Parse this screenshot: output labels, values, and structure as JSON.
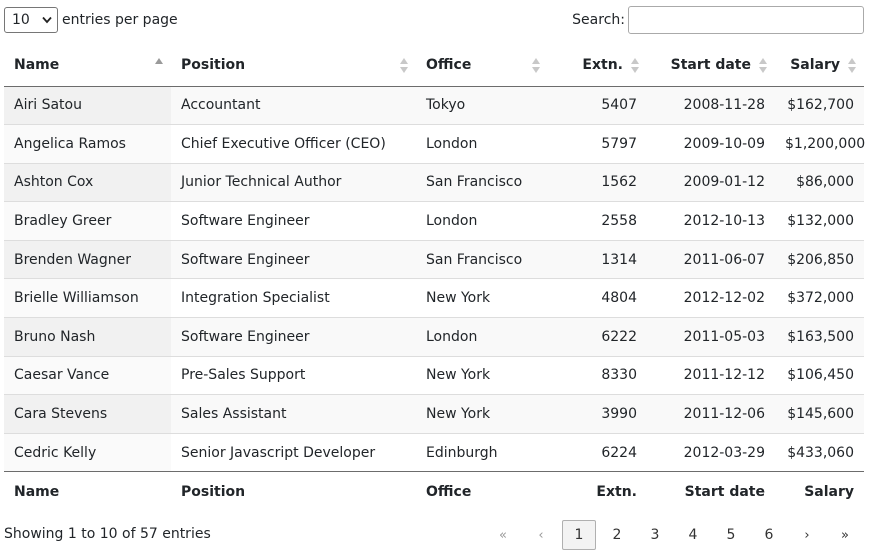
{
  "length": {
    "value": "10",
    "label": "entries per page"
  },
  "search": {
    "label": "Search:",
    "value": "",
    "placeholder": ""
  },
  "table": {
    "columns": [
      "Name",
      "Position",
      "Office",
      "Extn.",
      "Start date",
      "Salary"
    ],
    "rows": [
      [
        "Airi Satou",
        "Accountant",
        "Tokyo",
        "5407",
        "2008-11-28",
        "$162,700"
      ],
      [
        "Angelica Ramos",
        "Chief Executive Officer (CEO)",
        "London",
        "5797",
        "2009-10-09",
        "$1,200,000"
      ],
      [
        "Ashton Cox",
        "Junior Technical Author",
        "San Francisco",
        "1562",
        "2009-01-12",
        "$86,000"
      ],
      [
        "Bradley Greer",
        "Software Engineer",
        "London",
        "2558",
        "2012-10-13",
        "$132,000"
      ],
      [
        "Brenden Wagner",
        "Software Engineer",
        "San Francisco",
        "1314",
        "2011-06-07",
        "$206,850"
      ],
      [
        "Brielle Williamson",
        "Integration Specialist",
        "New York",
        "4804",
        "2012-12-02",
        "$372,000"
      ],
      [
        "Bruno Nash",
        "Software Engineer",
        "London",
        "6222",
        "2011-05-03",
        "$163,500"
      ],
      [
        "Caesar Vance",
        "Pre-Sales Support",
        "New York",
        "8330",
        "2011-12-12",
        "$106,450"
      ],
      [
        "Cara Stevens",
        "Sales Assistant",
        "New York",
        "3990",
        "2011-12-06",
        "$145,600"
      ],
      [
        "Cedric Kelly",
        "Senior Javascript Developer",
        "Edinburgh",
        "6224",
        "2012-03-29",
        "$433,060"
      ]
    ]
  },
  "info": "Showing 1 to 10 of 57 entries",
  "pager": {
    "first": "«",
    "prev": "‹",
    "pages": [
      "1",
      "2",
      "3",
      "4",
      "5",
      "6"
    ],
    "next": "›",
    "last": "»"
  },
  "colors": {
    "header_border": "#6c6c6c",
    "row_stripe": "#f9f9f9",
    "row_border": "#dddddd",
    "current_page_bg": "#f3f3f3"
  }
}
